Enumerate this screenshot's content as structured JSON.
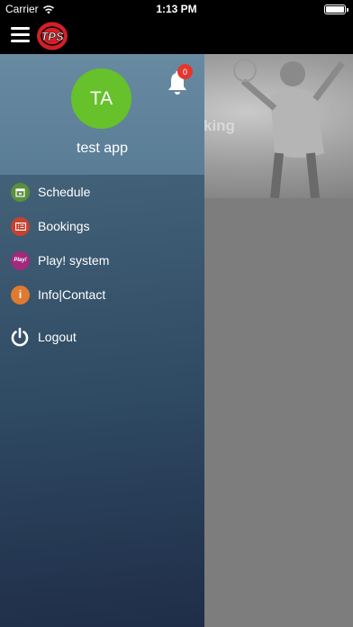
{
  "status_bar": {
    "carrier": "Carrier",
    "time": "1:13 PM"
  },
  "top_bar": {
    "menu_icon": "hamburger-icon",
    "logo_text": "TPS"
  },
  "hero": {
    "partial_text": "king"
  },
  "drawer": {
    "avatar_initials": "TA",
    "avatar_color": "#66c12a",
    "username": "test app",
    "notifications": {
      "icon": "bell-icon",
      "count": "0"
    },
    "menu_items": [
      {
        "label": "Schedule",
        "icon": "calendar-icon",
        "color": "#5a8f3c"
      },
      {
        "label": "Bookings",
        "icon": "ticket-icon",
        "color": "#c4422f"
      },
      {
        "label": "Play! system",
        "icon": "play-icon",
        "icon_text": "Play!",
        "color": "#a12a7c"
      },
      {
        "label": "Info|Contact",
        "icon": "info-icon",
        "icon_text": "i",
        "color": "#e07a30"
      }
    ],
    "logout": {
      "label": "Logout",
      "icon": "power-icon"
    }
  }
}
